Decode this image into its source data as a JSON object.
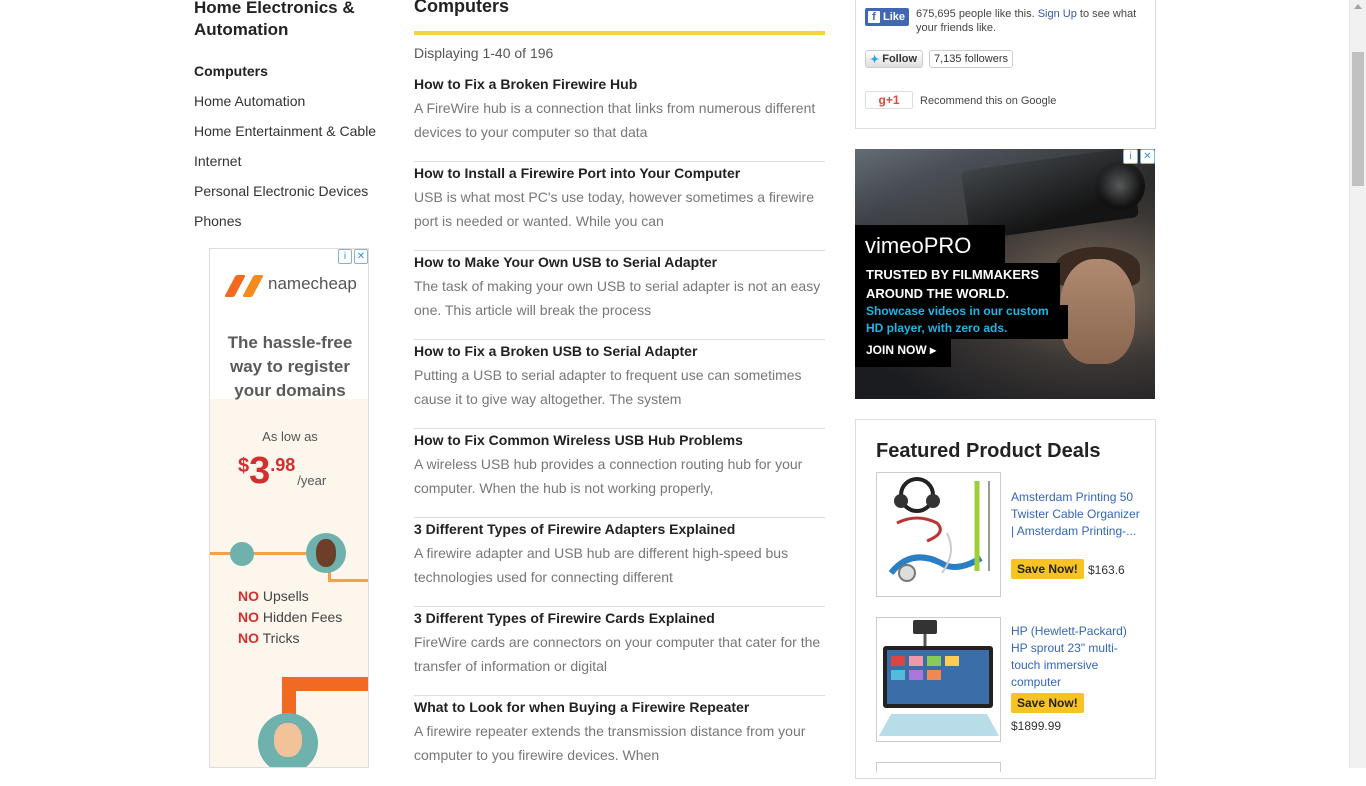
{
  "sidebar": {
    "heading": "Home Electronics & Automation",
    "items": [
      {
        "label": "Computers"
      },
      {
        "label": "Home Automation"
      },
      {
        "label": "Home Entertainment & Cable"
      },
      {
        "label": "Internet"
      },
      {
        "label": "Personal Electronic Devices"
      },
      {
        "label": "Phones"
      }
    ]
  },
  "ad_namecheap": {
    "brand": "namecheap",
    "tagline": "The hassle-free way to register your domains",
    "as_low_as": "As low as",
    "currency": "$",
    "price_whole": "3",
    "price_cents": ".98",
    "per": "/year",
    "no_word": "NO",
    "no1": " Upsells",
    "no2": " Hidden Fees",
    "no3": " Tricks"
  },
  "main": {
    "title": "Computers",
    "count": "Displaying 1-40 of 196",
    "articles": [
      {
        "title": "How to Fix a Broken Firewire Hub",
        "excerpt": "A FireWire hub is a connection that links from numerous different devices to your computer so that data"
      },
      {
        "title": "How to Install a Firewire Port into Your Computer",
        "excerpt": "USB is what most PC's use today, however sometimes a firewire port is needed or wanted. While you can"
      },
      {
        "title": "How to Make Your Own USB to Serial Adapter",
        "excerpt": "The task of making your own USB to serial adapter is not an easy one. This article will break the process"
      },
      {
        "title": "How to Fix a Broken USB to Serial Adapter",
        "excerpt": "Putting a USB to serial adapter to frequent use can sometimes cause it to give way altogether. The system"
      },
      {
        "title": "How to Fix Common Wireless USB Hub Problems",
        "excerpt": "A wireless USB hub provides a connection routing hub for your computer. When the hub is not working properly,"
      },
      {
        "title": "3 Different Types of Firewire Adapters Explained",
        "excerpt": "A firewire adapter and USB hub are different high-speed bus technologies used for connecting different"
      },
      {
        "title": "3 Different Types of Firewire Cards Explained",
        "excerpt": "FireWire cards are connectors on your computer that cater for the transfer of information or digital"
      },
      {
        "title": "What to Look for when Buying a Firewire Repeater",
        "excerpt": "A firewire repeater extends the transmission distance from your computer to you firewire devices. When"
      }
    ]
  },
  "social": {
    "fb_like": "Like",
    "fb_count": "675,695 people like this.",
    "fb_signup": "Sign Up",
    "fb_rest": " to see what your friends like.",
    "tw_follow": "Follow",
    "tw_followers": "7,135 followers",
    "gplus": "g+1",
    "gplus_text": "Recommend this on Google"
  },
  "ad_vimeo": {
    "logo": "vimeo",
    "logo_pro": "PRO",
    "line1": "TRUSTED BY FILMMAKERS",
    "line2": "AROUND THE WORLD.",
    "blue1": "Showcase videos in our custom",
    "blue2": "HD player, with zero ads.",
    "cta": "JOIN NOW ▸"
  },
  "deals": {
    "title": "Featured Product Deals",
    "items": [
      {
        "name": "Amsterdam Printing 50 Twister Cable Organizer | Amsterdam Printing-...",
        "button": "Save Now!",
        "price": "$163.6"
      },
      {
        "name": "HP (Hewlett-Packard) HP sprout 23\" multi-touch immersive computer",
        "button": "Save Now!",
        "price": "$1899.99"
      }
    ]
  },
  "icons": {
    "ad_info": "i-circle-icon",
    "ad_close": "close-icon",
    "facebook": "facebook-icon",
    "twitter": "twitter-bird-icon"
  },
  "colors": {
    "accent_yellow": "#f5d43b",
    "link_blue": "#3366bb",
    "save_yellow": "#f7c324",
    "namecheap_orange": "#f26a21",
    "vimeo_blue": "#1ab7ea"
  }
}
